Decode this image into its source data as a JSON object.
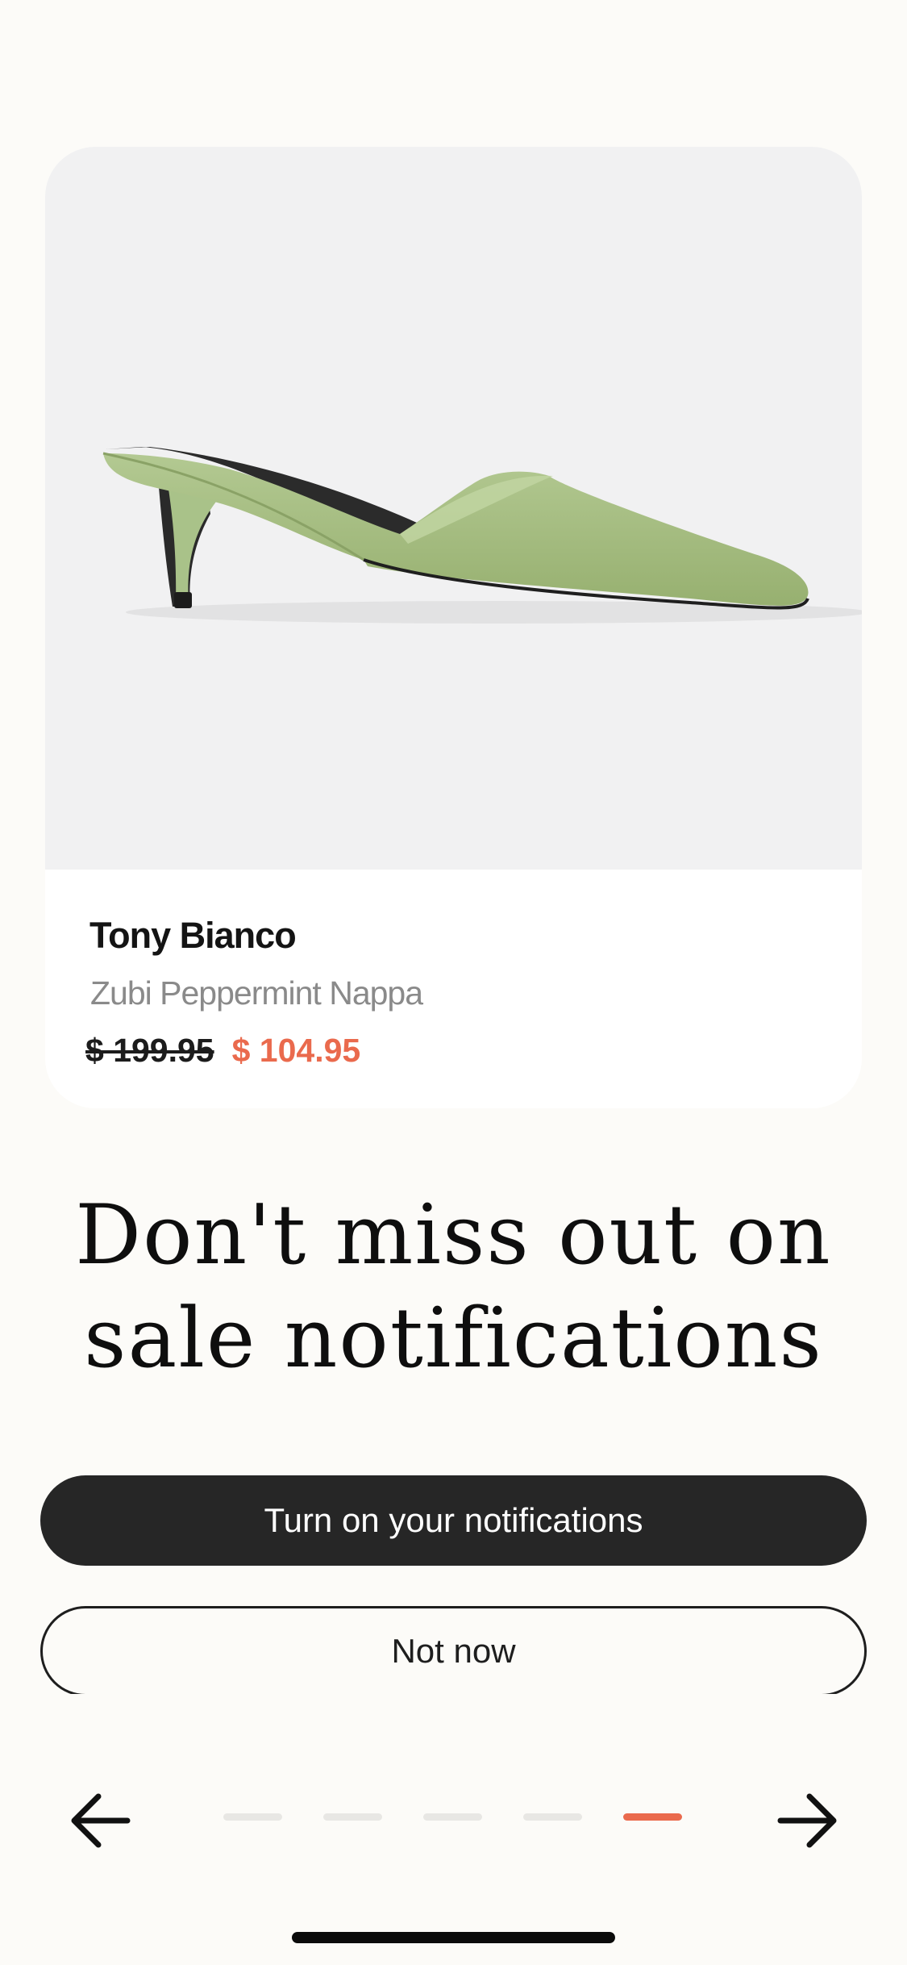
{
  "product": {
    "brand": "Tony Bianco",
    "name": "Zubi Peppermint Nappa",
    "old_price": "$ 199.95",
    "sale_price": "$ 104.95",
    "image_icon": "green-kitten-heel-mule-image"
  },
  "headline": {
    "line1": "Don't miss out on",
    "line2": "sale notifications"
  },
  "buttons": {
    "primary_label": "Turn on your notifications",
    "secondary_label": "Not now"
  },
  "pager": {
    "total_pages": 5,
    "current_page": 5,
    "back_icon": "arrow-left-icon",
    "next_icon": "arrow-right-icon"
  },
  "colors": {
    "background": "#fcfbf8",
    "accent": "#ea6a4d",
    "primary_button": "#262626",
    "shoe": "#a6bf84"
  }
}
